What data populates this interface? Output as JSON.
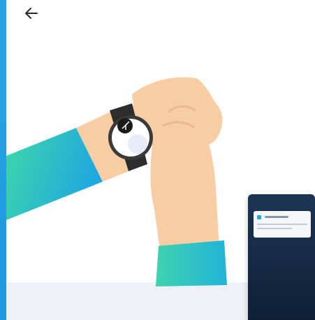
{
  "header": {
    "back_icon": "arrow-left-icon"
  },
  "illustration": {
    "subject": "hand-with-watch-icon",
    "phone": "phone-notification-icon"
  },
  "colors": {
    "accent": "#2aa3e6",
    "sleeve_start": "#3ed8a8",
    "sleeve_end": "#1fa7e0",
    "skin": "#f8cda3",
    "watch_body": "#2d2d2d",
    "phone_bg": "#132840",
    "floor": "#eef1f8"
  }
}
